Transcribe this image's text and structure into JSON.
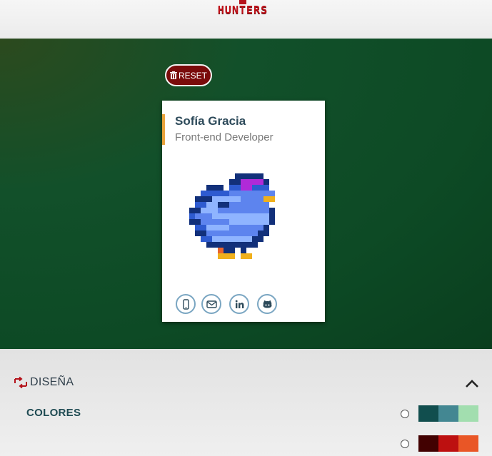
{
  "header": {
    "logo_text": "HUNTERS"
  },
  "reset": {
    "label": "RESET"
  },
  "card": {
    "name": "Sofía Gracia",
    "job": "Front-end Developer",
    "accent_color": "#e8a33c",
    "image_icon": "pixel-bird-icon",
    "social_icons": [
      "phone-icon",
      "mail-icon",
      "linkedin-icon",
      "github-icon"
    ]
  },
  "design": {
    "title": "DISEÑA",
    "icon": "design-icon",
    "colors_label": "COLORES",
    "palettes": [
      {
        "selected": false,
        "colors": [
          "#114e4e",
          "#438792",
          "#a2deaf"
        ]
      },
      {
        "selected": false,
        "colors": [
          "#420101",
          "#bd1010",
          "#e95626"
        ]
      }
    ]
  }
}
